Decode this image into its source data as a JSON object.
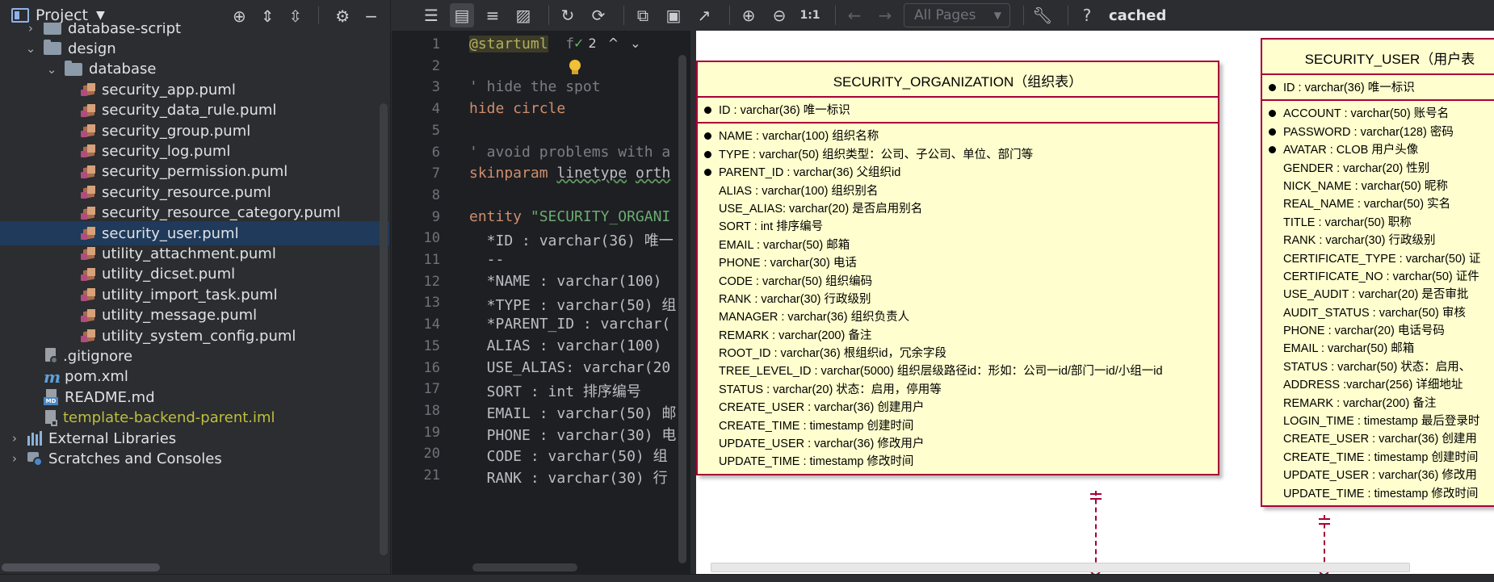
{
  "project": {
    "title": "Project",
    "tree": [
      {
        "label": "database-script",
        "type": "folder",
        "indent": 1,
        "chevron": "›"
      },
      {
        "label": "design",
        "type": "folder",
        "indent": 1,
        "chevron": "⌄"
      },
      {
        "label": "database",
        "type": "folder",
        "indent": 2,
        "chevron": "⌄"
      },
      {
        "label": "security_app.puml",
        "type": "puml",
        "indent": 3
      },
      {
        "label": "security_data_rule.puml",
        "type": "puml",
        "indent": 3
      },
      {
        "label": "security_group.puml",
        "type": "puml",
        "indent": 3
      },
      {
        "label": "security_log.puml",
        "type": "puml",
        "indent": 3
      },
      {
        "label": "security_permission.puml",
        "type": "puml",
        "indent": 3
      },
      {
        "label": "security_resource.puml",
        "type": "puml",
        "indent": 3
      },
      {
        "label": "security_resource_category.puml",
        "type": "puml",
        "indent": 3
      },
      {
        "label": "security_user.puml",
        "type": "puml",
        "indent": 3,
        "selected": true
      },
      {
        "label": "utility_attachment.puml",
        "type": "puml",
        "indent": 3
      },
      {
        "label": "utility_dicset.puml",
        "type": "puml",
        "indent": 3
      },
      {
        "label": "utility_import_task.puml",
        "type": "puml",
        "indent": 3
      },
      {
        "label": "utility_message.puml",
        "type": "puml",
        "indent": 3
      },
      {
        "label": "utility_system_config.puml",
        "type": "puml",
        "indent": 3
      },
      {
        "label": ".gitignore",
        "type": "gitignore",
        "indent": 1
      },
      {
        "label": "pom.xml",
        "type": "maven",
        "indent": 1
      },
      {
        "label": "README.md",
        "type": "md",
        "indent": 1
      },
      {
        "label": "template-backend-parent.iml",
        "type": "iml",
        "indent": 1,
        "yellow": true
      },
      {
        "label": "External Libraries",
        "type": "libs",
        "indent": 0,
        "chevron": "›"
      },
      {
        "label": "Scratches and Consoles",
        "type": "scratch",
        "indent": 0,
        "chevron": "›"
      }
    ]
  },
  "editor": {
    "inspection_count": "2",
    "lines": [
      {
        "n": "1",
        "html": "<span class='annot'>@startuml</span>  <span class='cm'>f</span>"
      },
      {
        "n": "2",
        "html": ""
      },
      {
        "n": "3",
        "html": "<span class='cm'>' hide the spot</span>"
      },
      {
        "n": "4",
        "html": "<span class='kw'>hide circle</span>"
      },
      {
        "n": "5",
        "html": ""
      },
      {
        "n": "6",
        "html": "<span class='cm'>' avoid problems with a</span>"
      },
      {
        "n": "7",
        "html": "<span class='kw'>skinparam</span> <span class='wavy'>linetype</span> <span class='wavy'>orth</span>"
      },
      {
        "n": "8",
        "html": ""
      },
      {
        "n": "9",
        "html": "<span class='kw'>entity</span> <span class='str'>\"SECURITY_ORGANI</span>"
      },
      {
        "n": "10",
        "html": "  *ID : varchar(36) 唯一"
      },
      {
        "n": "11",
        "html": "  --"
      },
      {
        "n": "12",
        "html": "  *NAME : varchar(100) "
      },
      {
        "n": "13",
        "html": "  *TYPE : varchar(50) 组"
      },
      {
        "n": "14",
        "html": "  *PARENT_ID : varchar("
      },
      {
        "n": "15",
        "html": "  ALIAS : varchar(100) "
      },
      {
        "n": "16",
        "html": "  USE_ALIAS: varchar(20"
      },
      {
        "n": "17",
        "html": "  SORT : int 排序编号"
      },
      {
        "n": "18",
        "html": "  EMAIL : varchar(50) 邮"
      },
      {
        "n": "19",
        "html": "  PHONE : varchar(30) 电"
      },
      {
        "n": "20",
        "html": "  CODE : varchar(50) 组"
      },
      {
        "n": "21",
        "html": "  RANK : varchar(30) 行"
      }
    ]
  },
  "toolbar": {
    "pages_select": "All Pages",
    "zoom_label": "1:1",
    "status_label": "cached"
  },
  "diagram": {
    "org": {
      "title": "SECURITY_ORGANIZATION（组织表）",
      "pk": [
        {
          "text": "ID : varchar(36) 唯一标识",
          "req": true
        }
      ],
      "fields": [
        {
          "text": "NAME : varchar(100) 组织名称",
          "req": true
        },
        {
          "text": "TYPE : varchar(50) 组织类型：公司、子公司、单位、部门等",
          "req": true
        },
        {
          "text": "PARENT_ID : varchar(36) 父组织id",
          "req": true
        },
        {
          "text": "ALIAS : varchar(100) 组织别名",
          "req": false
        },
        {
          "text": "USE_ALIAS: varchar(20) 是否启用别名",
          "req": false
        },
        {
          "text": "SORT : int 排序编号",
          "req": false
        },
        {
          "text": "EMAIL : varchar(50) 邮箱",
          "req": false
        },
        {
          "text": "PHONE : varchar(30) 电话",
          "req": false
        },
        {
          "text": "CODE : varchar(50) 组织编码",
          "req": false
        },
        {
          "text": "RANK : varchar(30) 行政级别",
          "req": false
        },
        {
          "text": "MANAGER : varchar(36) 组织负责人",
          "req": false
        },
        {
          "text": "REMARK : varchar(200) 备注",
          "req": false
        },
        {
          "text": "ROOT_ID : varchar(36) 根组织id，冗余字段",
          "req": false
        },
        {
          "text": "TREE_LEVEL_ID : varchar(5000) 组织层级路径id：形如：公司一id/部门一id/小组一id",
          "req": false
        },
        {
          "text": "STATUS : varchar(20) 状态：启用，停用等",
          "req": false
        },
        {
          "text": "CREATE_USER : varchar(36) 创建用户",
          "req": false
        },
        {
          "text": "CREATE_TIME : timestamp 创建时间",
          "req": false
        },
        {
          "text": "UPDATE_USER : varchar(36) 修改用户",
          "req": false
        },
        {
          "text": "UPDATE_TIME : timestamp 修改时间",
          "req": false
        }
      ]
    },
    "user": {
      "title": "SECURITY_USER（用户表",
      "pk": [
        {
          "text": "ID : varchar(36) 唯一标识",
          "req": true
        }
      ],
      "fields": [
        {
          "text": "ACCOUNT : varchar(50) 账号名",
          "req": true
        },
        {
          "text": "PASSWORD : varchar(128) 密码",
          "req": true
        },
        {
          "text": "AVATAR : CLOB 用户头像",
          "req": true
        },
        {
          "text": "GENDER : varchar(20) 性别",
          "req": false
        },
        {
          "text": "NICK_NAME : varchar(50) 昵称",
          "req": false
        },
        {
          "text": "REAL_NAME : varchar(50) 实名",
          "req": false
        },
        {
          "text": "TITLE : varchar(50) 职称",
          "req": false
        },
        {
          "text": "RANK : varchar(30) 行政级别",
          "req": false
        },
        {
          "text": "CERTIFICATE_TYPE : varchar(50) 证",
          "req": false
        },
        {
          "text": "CERTIFICATE_NO : varchar(50) 证件",
          "req": false
        },
        {
          "text": "USE_AUDIT : varchar(20) 是否审批",
          "req": false
        },
        {
          "text": "AUDIT_STATUS : varchar(50) 审核",
          "req": false
        },
        {
          "text": "PHONE : varchar(20) 电话号码",
          "req": false
        },
        {
          "text": "EMAIL : varchar(50) 邮箱",
          "req": false
        },
        {
          "text": "STATUS : varchar(50) 状态：启用、",
          "req": false
        },
        {
          "text": "ADDRESS :varchar(256) 详细地址",
          "req": false
        },
        {
          "text": "REMARK : varchar(200) 备注",
          "req": false
        },
        {
          "text": "LOGIN_TIME : timestamp 最后登录时",
          "req": false
        },
        {
          "text": "CREATE_USER : varchar(36) 创建用",
          "req": false
        },
        {
          "text": "CREATE_TIME : timestamp 创建时间",
          "req": false
        },
        {
          "text": "UPDATE_USER : varchar(36) 修改用",
          "req": false
        },
        {
          "text": "UPDATE_TIME : timestamp 修改时间",
          "req": false
        }
      ]
    }
  }
}
